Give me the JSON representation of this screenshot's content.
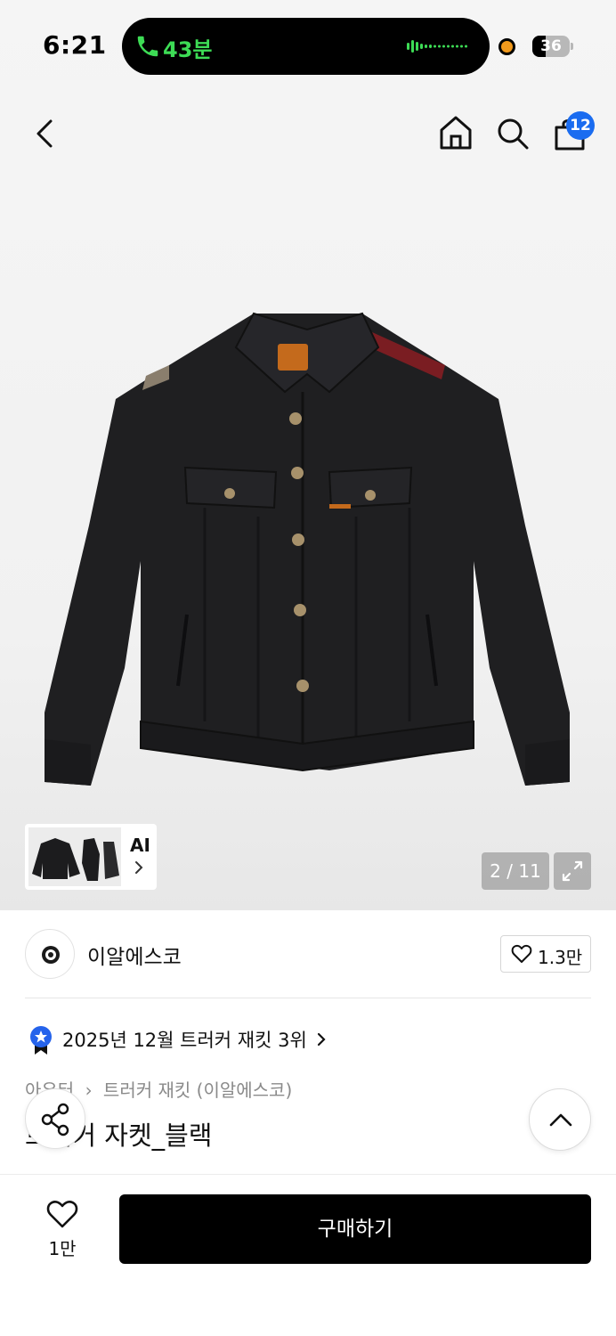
{
  "status_bar": {
    "time": "6:21",
    "call_duration": "43분",
    "battery_level": "36",
    "battery_fraction": 0.36
  },
  "nav": {
    "cart_count": "12"
  },
  "gallery": {
    "ai_label": "AI",
    "page_counter": "2 / 11"
  },
  "brand": {
    "name": "이알에스코",
    "like_count": "1.3만"
  },
  "ranking": {
    "text": "2025년 12월 트러커 재킷 3위"
  },
  "breadcrumb": {
    "category": "아우터",
    "subcategory": "트러커 재킷 (이알에스코)"
  },
  "product": {
    "title": "트러커 자켓_블랙"
  },
  "bottom_bar": {
    "wish_count": "1만",
    "buy_label": "구매하기"
  },
  "colors": {
    "accent_blue": "#1a6cf0",
    "call_green": "#3ddc55",
    "record_orange": "#f29a1c",
    "buy_button": "#000000"
  }
}
